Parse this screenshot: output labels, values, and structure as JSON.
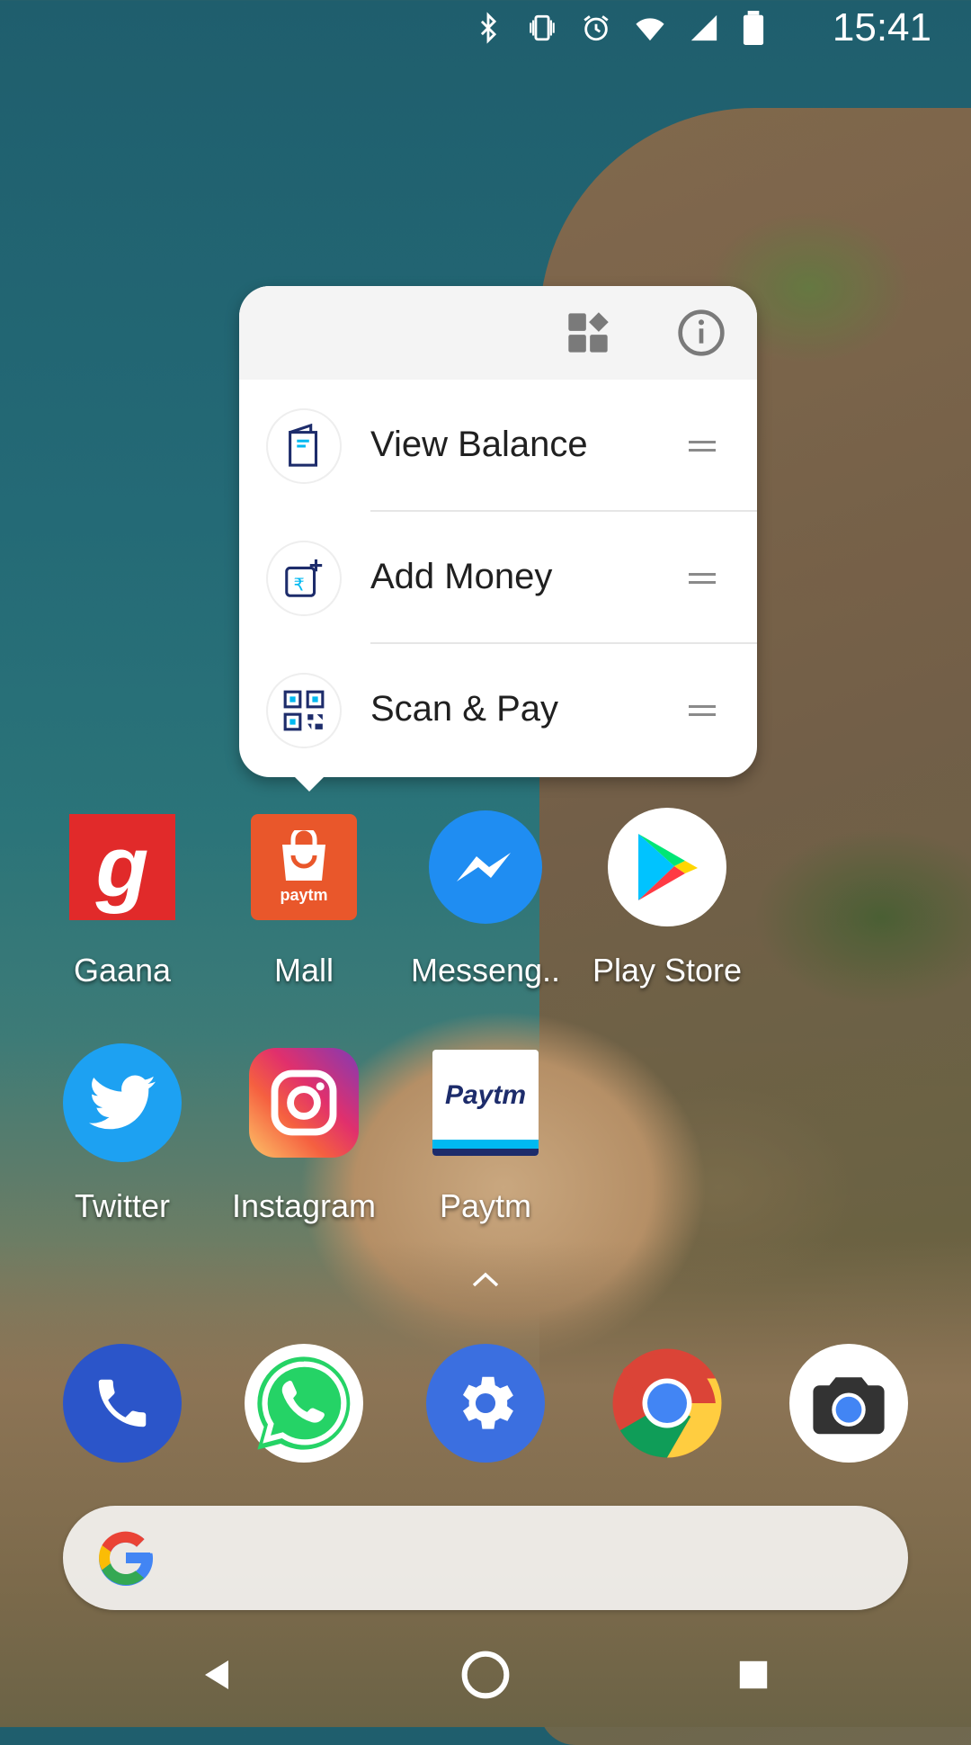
{
  "status_bar": {
    "time": "15:41",
    "icons": [
      "bluetooth-icon",
      "vibrate-icon",
      "alarm-icon",
      "wifi-icon",
      "signal-icon",
      "battery-icon"
    ]
  },
  "shortcut_popup": {
    "app": "Mall",
    "header_actions": [
      "widgets-icon",
      "app-info-icon"
    ],
    "items": [
      {
        "label": "View Balance",
        "icon": "wallet-icon"
      },
      {
        "label": "Add Money",
        "icon": "add-money-icon"
      },
      {
        "label": "Scan & Pay",
        "icon": "qr-code-icon"
      }
    ]
  },
  "apps": [
    {
      "name": "Gaana",
      "icon_text": "g"
    },
    {
      "name": "Mall",
      "icon_text": "paytm"
    },
    {
      "name": "Messeng..",
      "icon_text": ""
    },
    {
      "name": "Play Store",
      "icon_text": ""
    },
    {
      "name": "Twitter",
      "icon_text": ""
    },
    {
      "name": "Instagram",
      "icon_text": ""
    },
    {
      "name": "Paytm",
      "icon_text": "Paytm"
    }
  ],
  "dock": [
    "phone-icon",
    "whatsapp-icon",
    "settings-icon",
    "chrome-icon",
    "camera-icon"
  ],
  "search_bar": {
    "logo": "G"
  },
  "colors": {
    "gaana": "#e12a2a",
    "mall": "#e9572b",
    "messenger": "#1f8df2",
    "twitter": "#1da1f2",
    "paytm_blue": "#1d2c6b",
    "paytm_cyan": "#00b9f1"
  }
}
